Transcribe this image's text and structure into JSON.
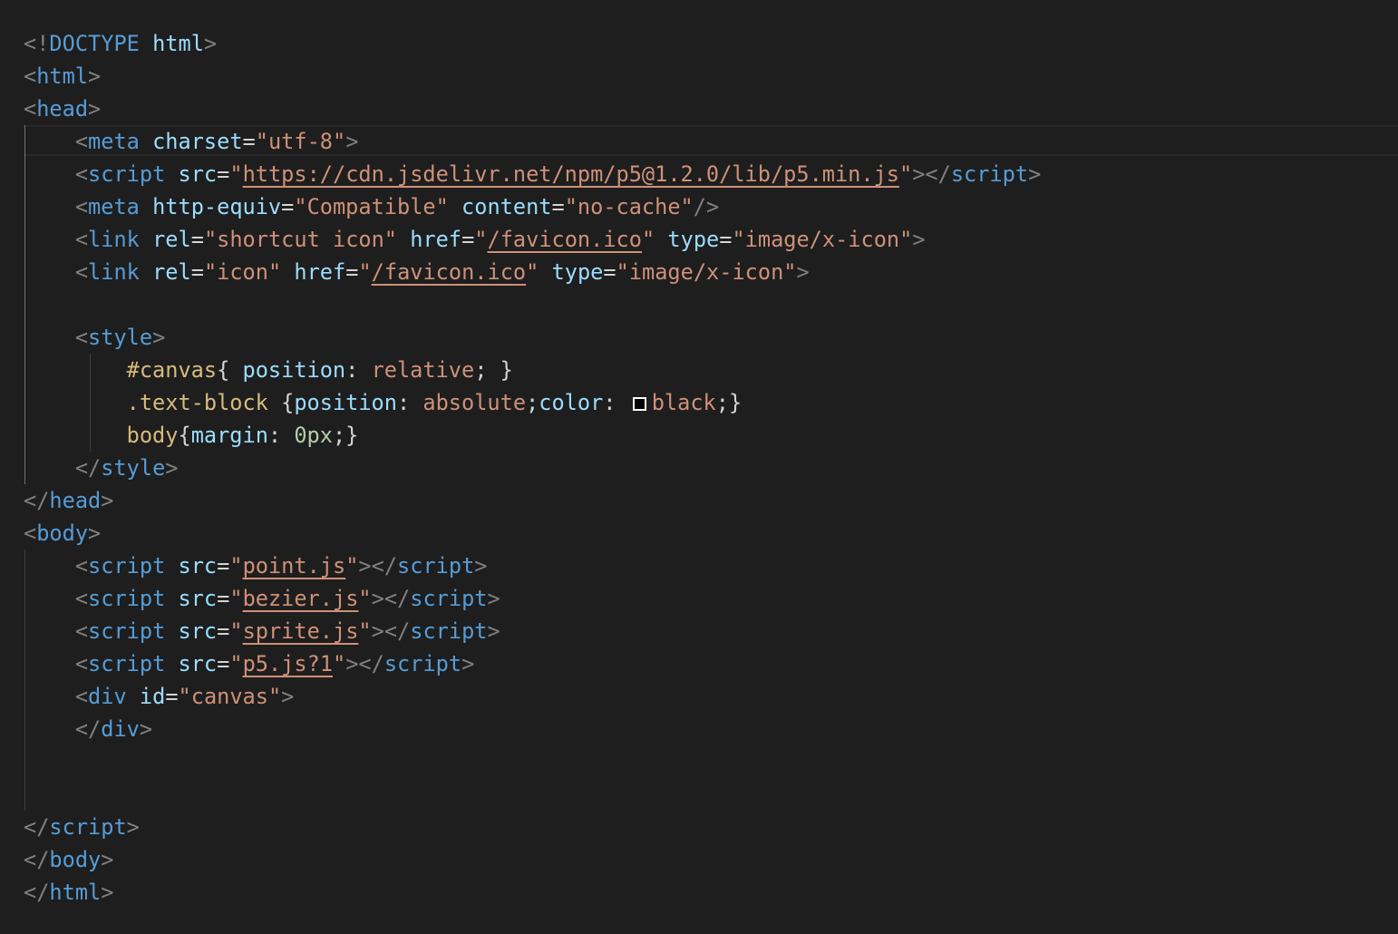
{
  "editor": {
    "colors": {
      "background": "#1e1e1e",
      "tag": "#569cd6",
      "attribute": "#9cdcfe",
      "string": "#ce9178",
      "punctuation": "#808080",
      "selector": "#d7ba7d",
      "number": "#b5cea8"
    },
    "lines": [
      {
        "tokens": [
          {
            "t": "<!",
            "c": "punct"
          },
          {
            "t": "DOCTYPE",
            "c": "tag"
          },
          {
            "t": " ",
            "c": "plain"
          },
          {
            "t": "html",
            "c": "attr"
          },
          {
            "t": ">",
            "c": "punct"
          }
        ]
      },
      {
        "tokens": [
          {
            "t": "<",
            "c": "punct"
          },
          {
            "t": "html",
            "c": "tag"
          },
          {
            "t": ">",
            "c": "punct"
          }
        ]
      },
      {
        "tokens": [
          {
            "t": "<",
            "c": "punct"
          },
          {
            "t": "head",
            "c": "tag"
          },
          {
            "t": ">",
            "c": "punct"
          }
        ]
      },
      {
        "tokens": [
          {
            "t": "    ",
            "c": "plain"
          },
          {
            "t": "<",
            "c": "punct"
          },
          {
            "t": "meta",
            "c": "tag"
          },
          {
            "t": " ",
            "c": "plain"
          },
          {
            "t": "charset",
            "c": "attr"
          },
          {
            "t": "=",
            "c": "plain"
          },
          {
            "t": "\"utf-8\"",
            "c": "str"
          },
          {
            "t": ">",
            "c": "punct"
          }
        ]
      },
      {
        "tokens": [
          {
            "t": "    ",
            "c": "plain"
          },
          {
            "t": "<",
            "c": "punct"
          },
          {
            "t": "script",
            "c": "tag"
          },
          {
            "t": " ",
            "c": "plain"
          },
          {
            "t": "src",
            "c": "attr"
          },
          {
            "t": "=",
            "c": "plain"
          },
          {
            "t": "\"",
            "c": "str"
          },
          {
            "t": "https://cdn.jsdelivr.net/npm/p5@1.2.0/lib/p5.min.js",
            "c": "link"
          },
          {
            "t": "\"",
            "c": "str"
          },
          {
            "t": "></",
            "c": "punct"
          },
          {
            "t": "script",
            "c": "tag"
          },
          {
            "t": ">",
            "c": "punct"
          }
        ]
      },
      {
        "tokens": [
          {
            "t": "    ",
            "c": "plain"
          },
          {
            "t": "<",
            "c": "punct"
          },
          {
            "t": "meta",
            "c": "tag"
          },
          {
            "t": " ",
            "c": "plain"
          },
          {
            "t": "http-equiv",
            "c": "attr"
          },
          {
            "t": "=",
            "c": "plain"
          },
          {
            "t": "\"Compatible\"",
            "c": "str"
          },
          {
            "t": " ",
            "c": "plain"
          },
          {
            "t": "content",
            "c": "attr"
          },
          {
            "t": "=",
            "c": "plain"
          },
          {
            "t": "\"no-cache\"",
            "c": "str"
          },
          {
            "t": "/>",
            "c": "punct"
          }
        ]
      },
      {
        "tokens": [
          {
            "t": "    ",
            "c": "plain"
          },
          {
            "t": "<",
            "c": "punct"
          },
          {
            "t": "link",
            "c": "tag"
          },
          {
            "t": " ",
            "c": "plain"
          },
          {
            "t": "rel",
            "c": "attr"
          },
          {
            "t": "=",
            "c": "plain"
          },
          {
            "t": "\"shortcut icon\"",
            "c": "str"
          },
          {
            "t": " ",
            "c": "plain"
          },
          {
            "t": "href",
            "c": "attr"
          },
          {
            "t": "=",
            "c": "plain"
          },
          {
            "t": "\"",
            "c": "str"
          },
          {
            "t": "/favicon.ico",
            "c": "link"
          },
          {
            "t": "\"",
            "c": "str"
          },
          {
            "t": " ",
            "c": "plain"
          },
          {
            "t": "type",
            "c": "attr"
          },
          {
            "t": "=",
            "c": "plain"
          },
          {
            "t": "\"image/x-icon\"",
            "c": "str"
          },
          {
            "t": ">",
            "c": "punct"
          }
        ]
      },
      {
        "tokens": [
          {
            "t": "    ",
            "c": "plain"
          },
          {
            "t": "<",
            "c": "punct"
          },
          {
            "t": "link",
            "c": "tag"
          },
          {
            "t": " ",
            "c": "plain"
          },
          {
            "t": "rel",
            "c": "attr"
          },
          {
            "t": "=",
            "c": "plain"
          },
          {
            "t": "\"icon\"",
            "c": "str"
          },
          {
            "t": " ",
            "c": "plain"
          },
          {
            "t": "href",
            "c": "attr"
          },
          {
            "t": "=",
            "c": "plain"
          },
          {
            "t": "\"",
            "c": "str"
          },
          {
            "t": "/favicon.ico",
            "c": "link"
          },
          {
            "t": "\"",
            "c": "str"
          },
          {
            "t": " ",
            "c": "plain"
          },
          {
            "t": "type",
            "c": "attr"
          },
          {
            "t": "=",
            "c": "plain"
          },
          {
            "t": "\"image/x-icon\"",
            "c": "str"
          },
          {
            "t": ">",
            "c": "punct"
          }
        ]
      },
      {
        "tokens": []
      },
      {
        "tokens": [
          {
            "t": "    ",
            "c": "plain"
          },
          {
            "t": "<",
            "c": "punct"
          },
          {
            "t": "style",
            "c": "tag"
          },
          {
            "t": ">",
            "c": "punct"
          }
        ]
      },
      {
        "tokens": [
          {
            "t": "        ",
            "c": "plain"
          },
          {
            "t": "#canvas",
            "c": "sel"
          },
          {
            "t": "{ ",
            "c": "plain"
          },
          {
            "t": "position",
            "c": "prop"
          },
          {
            "t": ": ",
            "c": "plain"
          },
          {
            "t": "relative",
            "c": "val"
          },
          {
            "t": "; }",
            "c": "plain"
          }
        ]
      },
      {
        "tokens": [
          {
            "t": "        ",
            "c": "plain"
          },
          {
            "t": ".text-block",
            "c": "sel"
          },
          {
            "t": " {",
            "c": "plain"
          },
          {
            "t": "position",
            "c": "prop"
          },
          {
            "t": ": ",
            "c": "plain"
          },
          {
            "t": "absolute",
            "c": "val"
          },
          {
            "t": ";",
            "c": "plain"
          },
          {
            "t": "color",
            "c": "prop"
          },
          {
            "t": ": ",
            "c": "plain"
          },
          {
            "t": "",
            "c": "swatch"
          },
          {
            "t": "black",
            "c": "val"
          },
          {
            "t": ";}",
            "c": "plain"
          }
        ]
      },
      {
        "tokens": [
          {
            "t": "        ",
            "c": "plain"
          },
          {
            "t": "body",
            "c": "sel"
          },
          {
            "t": "{",
            "c": "plain"
          },
          {
            "t": "margin",
            "c": "prop"
          },
          {
            "t": ": ",
            "c": "plain"
          },
          {
            "t": "0px",
            "c": "num"
          },
          {
            "t": ";}",
            "c": "plain"
          }
        ]
      },
      {
        "tokens": [
          {
            "t": "    ",
            "c": "plain"
          },
          {
            "t": "</",
            "c": "punct"
          },
          {
            "t": "style",
            "c": "tag"
          },
          {
            "t": ">",
            "c": "punct"
          }
        ]
      },
      {
        "tokens": [
          {
            "t": "</",
            "c": "punct"
          },
          {
            "t": "head",
            "c": "tag"
          },
          {
            "t": ">",
            "c": "punct"
          }
        ]
      },
      {
        "tokens": [
          {
            "t": "<",
            "c": "punct"
          },
          {
            "t": "body",
            "c": "tag"
          },
          {
            "t": ">",
            "c": "punct"
          }
        ]
      },
      {
        "tokens": [
          {
            "t": "    ",
            "c": "plain"
          },
          {
            "t": "<",
            "c": "punct"
          },
          {
            "t": "script",
            "c": "tag"
          },
          {
            "t": " ",
            "c": "plain"
          },
          {
            "t": "src",
            "c": "attr"
          },
          {
            "t": "=",
            "c": "plain"
          },
          {
            "t": "\"",
            "c": "str"
          },
          {
            "t": "point.js",
            "c": "link"
          },
          {
            "t": "\"",
            "c": "str"
          },
          {
            "t": "></",
            "c": "punct"
          },
          {
            "t": "script",
            "c": "tag"
          },
          {
            "t": ">",
            "c": "punct"
          }
        ]
      },
      {
        "tokens": [
          {
            "t": "    ",
            "c": "plain"
          },
          {
            "t": "<",
            "c": "punct"
          },
          {
            "t": "script",
            "c": "tag"
          },
          {
            "t": " ",
            "c": "plain"
          },
          {
            "t": "src",
            "c": "attr"
          },
          {
            "t": "=",
            "c": "plain"
          },
          {
            "t": "\"",
            "c": "str"
          },
          {
            "t": "bezier.js",
            "c": "link"
          },
          {
            "t": "\"",
            "c": "str"
          },
          {
            "t": "></",
            "c": "punct"
          },
          {
            "t": "script",
            "c": "tag"
          },
          {
            "t": ">",
            "c": "punct"
          }
        ]
      },
      {
        "tokens": [
          {
            "t": "    ",
            "c": "plain"
          },
          {
            "t": "<",
            "c": "punct"
          },
          {
            "t": "script",
            "c": "tag"
          },
          {
            "t": " ",
            "c": "plain"
          },
          {
            "t": "src",
            "c": "attr"
          },
          {
            "t": "=",
            "c": "plain"
          },
          {
            "t": "\"",
            "c": "str"
          },
          {
            "t": "sprite.js",
            "c": "link"
          },
          {
            "t": "\"",
            "c": "str"
          },
          {
            "t": "></",
            "c": "punct"
          },
          {
            "t": "script",
            "c": "tag"
          },
          {
            "t": ">",
            "c": "punct"
          }
        ]
      },
      {
        "tokens": [
          {
            "t": "    ",
            "c": "plain"
          },
          {
            "t": "<",
            "c": "punct"
          },
          {
            "t": "script",
            "c": "tag"
          },
          {
            "t": " ",
            "c": "plain"
          },
          {
            "t": "src",
            "c": "attr"
          },
          {
            "t": "=",
            "c": "plain"
          },
          {
            "t": "\"",
            "c": "str"
          },
          {
            "t": "p5.js?1",
            "c": "link"
          },
          {
            "t": "\"",
            "c": "str"
          },
          {
            "t": "></",
            "c": "punct"
          },
          {
            "t": "script",
            "c": "tag"
          },
          {
            "t": ">",
            "c": "punct"
          }
        ]
      },
      {
        "tokens": [
          {
            "t": "    ",
            "c": "plain"
          },
          {
            "t": "<",
            "c": "punct"
          },
          {
            "t": "div",
            "c": "tag"
          },
          {
            "t": " ",
            "c": "plain"
          },
          {
            "t": "id",
            "c": "attr"
          },
          {
            "t": "=",
            "c": "plain"
          },
          {
            "t": "\"canvas\"",
            "c": "str"
          },
          {
            "t": ">",
            "c": "punct"
          }
        ]
      },
      {
        "tokens": [
          {
            "t": "    ",
            "c": "plain"
          },
          {
            "t": "</",
            "c": "punct"
          },
          {
            "t": "div",
            "c": "tag"
          },
          {
            "t": ">",
            "c": "punct"
          }
        ]
      },
      {
        "tokens": []
      },
      {
        "tokens": []
      },
      {
        "tokens": [
          {
            "t": "</",
            "c": "punct"
          },
          {
            "t": "script",
            "c": "tag"
          },
          {
            "t": ">",
            "c": "punct"
          }
        ]
      },
      {
        "tokens": [
          {
            "t": "</",
            "c": "punct"
          },
          {
            "t": "body",
            "c": "tag"
          },
          {
            "t": ">",
            "c": "punct"
          }
        ]
      },
      {
        "tokens": [
          {
            "t": "</",
            "c": "punct"
          },
          {
            "t": "html",
            "c": "tag"
          },
          {
            "t": ">",
            "c": "punct"
          }
        ]
      }
    ]
  }
}
